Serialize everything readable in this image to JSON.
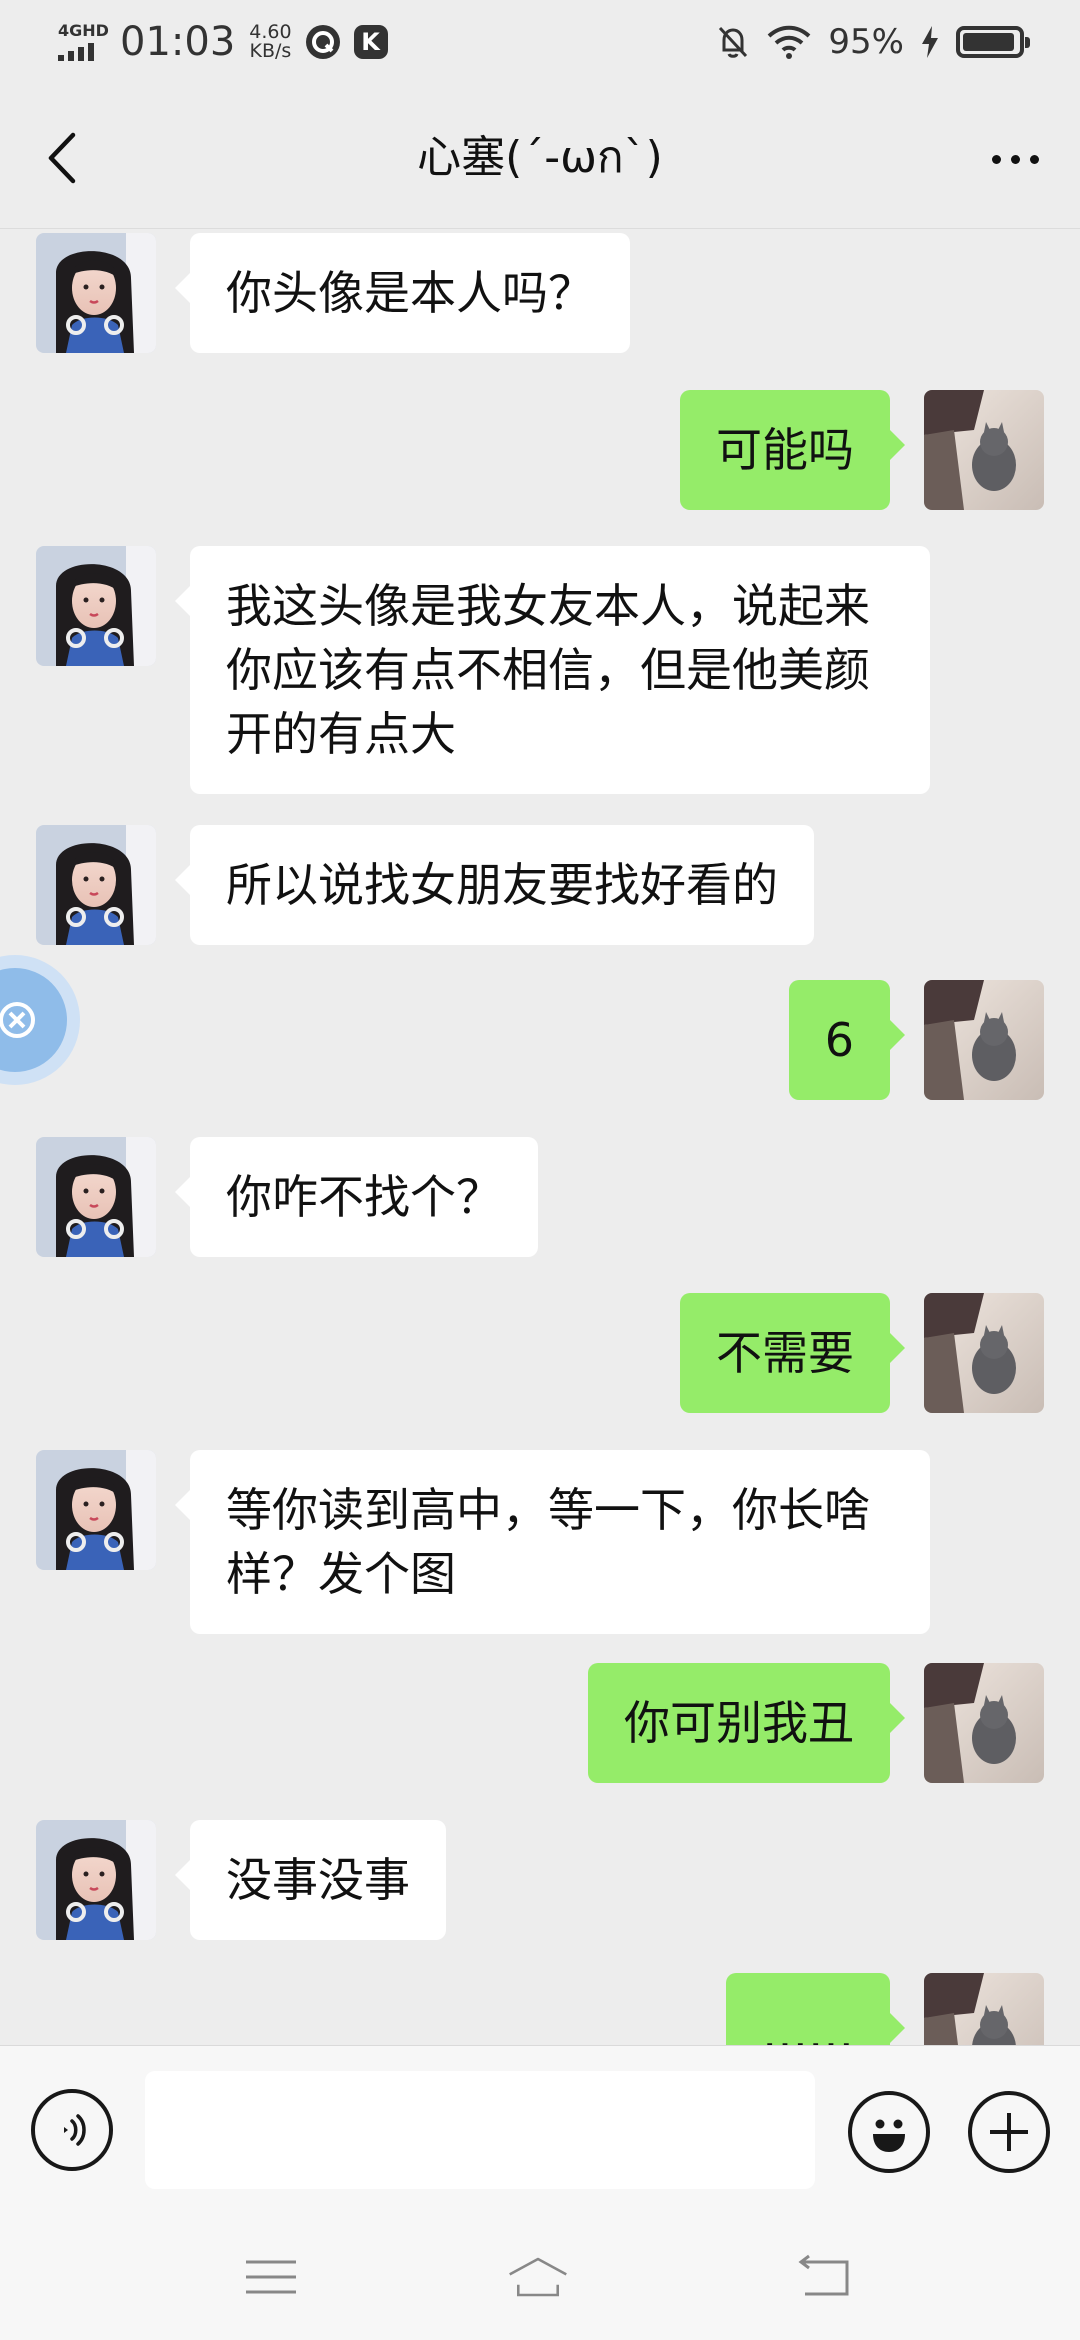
{
  "status_bar": {
    "network": "4GHD",
    "time": "01:03",
    "speed_value": "4.60",
    "speed_unit": "KB/s",
    "app_icon_letter": "K",
    "battery": "95%",
    "battery_level": 0.95
  },
  "header": {
    "title": "心塞(´-ωก`)",
    "back_icon": "chevron-left-icon",
    "more_icon": "more-icon"
  },
  "messages": [
    {
      "side": "left",
      "text": "你头像是本人吗？"
    },
    {
      "side": "right",
      "text": "可能吗"
    },
    {
      "side": "left",
      "text": "我这头像是我女友本人，说起来你应该有点不相信，但是他美颜开的有点大"
    },
    {
      "side": "left",
      "text": "所以说找女朋友要找好看的"
    },
    {
      "side": "right",
      "text": "6"
    },
    {
      "side": "left",
      "text": "你咋不找个？"
    },
    {
      "side": "right",
      "text": "不需要"
    },
    {
      "side": "left",
      "text": "等你读到高中，等一下，你长啥样？发个图"
    },
    {
      "side": "right",
      "text": "你可别我丑"
    },
    {
      "side": "left",
      "text": "没事没事"
    },
    {
      "side": "right",
      "text": "……"
    }
  ],
  "input_bar": {
    "voice_icon": "voice-icon",
    "input_value": "",
    "emoji_icon": "emoji-icon",
    "plus_icon": "plus-icon"
  },
  "nav_bar": {
    "menu_icon": "menu-icon",
    "home_icon": "home-icon",
    "back_icon": "back-icon"
  },
  "colors": {
    "background": "#ededed",
    "sent_bubble": "#95ec69",
    "received_bubble": "#ffffff",
    "floating_button": "#8fbce9"
  }
}
